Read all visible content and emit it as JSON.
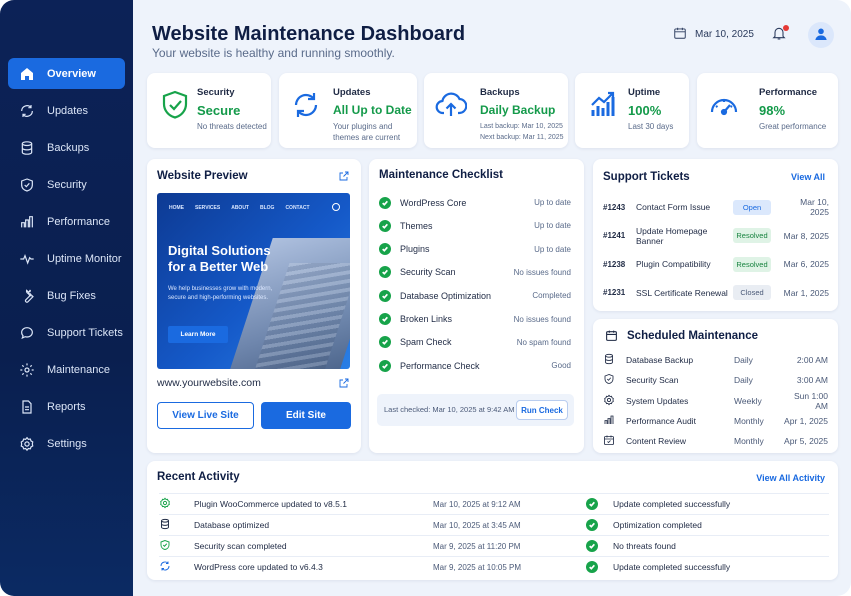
{
  "sidebar": {
    "items": [
      {
        "label": "Overview",
        "icon": "home-icon"
      },
      {
        "label": "Updates",
        "icon": "refresh-icon"
      },
      {
        "label": "Backups",
        "icon": "database-icon"
      },
      {
        "label": "Security",
        "icon": "shield-icon"
      },
      {
        "label": "Performance",
        "icon": "bar-chart-icon"
      },
      {
        "label": "Uptime Monitor",
        "icon": "pulse-icon"
      },
      {
        "label": "Bug Fixes",
        "icon": "wrench-icon"
      },
      {
        "label": "Support Tickets",
        "icon": "chat-icon"
      },
      {
        "label": "Maintenance",
        "icon": "gear-icon"
      },
      {
        "label": "Reports",
        "icon": "document-icon"
      },
      {
        "label": "Settings",
        "icon": "settings-icon"
      }
    ],
    "active": "Overview"
  },
  "header": {
    "title": "Website Maintenance Dashboard",
    "subtitle": "Your website is healthy and running smoothly.",
    "date": "Mar 10, 2025"
  },
  "stats": {
    "security": {
      "label": "Security",
      "value": "Secure",
      "sub": "No threats detected"
    },
    "updates": {
      "label": "Updates",
      "value": "All Up to Date",
      "sub1": "Your plugins and",
      "sub2": "themes are current"
    },
    "backups": {
      "label": "Backups",
      "value": "Daily Backup",
      "sub1": "Last backup: Mar 10, 2025",
      "sub2": "Next backup: Mar 11, 2025"
    },
    "uptime": {
      "label": "Uptime",
      "value": "100%",
      "sub": "Last 30 days"
    },
    "performance": {
      "label": "Performance",
      "value": "98%",
      "sub": "Great performance"
    }
  },
  "preview": {
    "title": "Website Preview",
    "nav": [
      "HOME",
      "SERVICES",
      "ABOUT",
      "BLOG",
      "CONTACT"
    ],
    "headline": "Digital Solutions for a Better Web",
    "text": "We help businesses grow with modern, secure and high-performing websites.",
    "cta": "Learn More",
    "url": "www.yourwebsite.com",
    "view_live": "View Live Site",
    "edit": "Edit Site"
  },
  "checklist": {
    "title": "Maintenance Checklist",
    "items": [
      {
        "name": "WordPress Core",
        "status": "Up to date"
      },
      {
        "name": "Themes",
        "status": "Up to date"
      },
      {
        "name": "Plugins",
        "status": "Up to date"
      },
      {
        "name": "Security Scan",
        "status": "No issues found"
      },
      {
        "name": "Database Optimization",
        "status": "Completed"
      },
      {
        "name": "Broken Links",
        "status": "No issues found"
      },
      {
        "name": "Spam Check",
        "status": "No spam found"
      },
      {
        "name": "Performance Check",
        "status": "Good"
      }
    ],
    "last_checked": "Last checked: Mar 10, 2025 at 9:42 AM",
    "run_check": "Run Check"
  },
  "tickets": {
    "title": "Support Tickets",
    "view_all": "View All",
    "items": [
      {
        "id": "#1243",
        "name": "Contact Form Issue",
        "status": "Open",
        "date": "Mar 10, 2025"
      },
      {
        "id": "#1241",
        "name": "Update Homepage Banner",
        "status": "Resolved",
        "date": "Mar 8, 2025"
      },
      {
        "id": "#1238",
        "name": "Plugin Compatibility",
        "status": "Resolved",
        "date": "Mar 6, 2025"
      },
      {
        "id": "#1231",
        "name": "SSL Certificate Renewal",
        "status": "Closed",
        "date": "Mar 1, 2025"
      }
    ]
  },
  "scheduled": {
    "title": "Scheduled Maintenance",
    "items": [
      {
        "name": "Database Backup",
        "freq": "Daily",
        "time": "2:00 AM",
        "icon": "database-icon"
      },
      {
        "name": "Security Scan",
        "freq": "Daily",
        "time": "3:00 AM",
        "icon": "shield-icon"
      },
      {
        "name": "System Updates",
        "freq": "Weekly",
        "time": "Sun 1:00 AM",
        "icon": "gear-icon"
      },
      {
        "name": "Performance Audit",
        "freq": "Monthly",
        "time": "Apr 1, 2025",
        "icon": "bar-chart-icon"
      },
      {
        "name": "Content Review",
        "freq": "Monthly",
        "time": "Apr 5, 2025",
        "icon": "calendar-check-icon"
      }
    ]
  },
  "activity": {
    "title": "Recent Activity",
    "view_all": "View All Activity",
    "items": [
      {
        "event": "Plugin WooCommerce updated to v8.5.1",
        "time": "Mar 10, 2025 at 9:12 AM",
        "result": "Update completed successfully",
        "icon": "gear-icon"
      },
      {
        "event": "Database optimized",
        "time": "Mar 10, 2025 at 3:45 AM",
        "result": "Optimization completed",
        "icon": "database-icon"
      },
      {
        "event": "Security scan completed",
        "time": "Mar 9, 2025 at 11:20 PM",
        "result": "No threats found",
        "icon": "shield-icon"
      },
      {
        "event": "WordPress core updated to v6.4.3",
        "time": "Mar 9, 2025 at 10:05 PM",
        "result": "Update completed successfully",
        "icon": "refresh-icon"
      }
    ]
  },
  "colors": {
    "accent": "#1a6ae0",
    "sidebar": "#0c2257",
    "success": "#17a34a",
    "danger": "#e53935"
  }
}
